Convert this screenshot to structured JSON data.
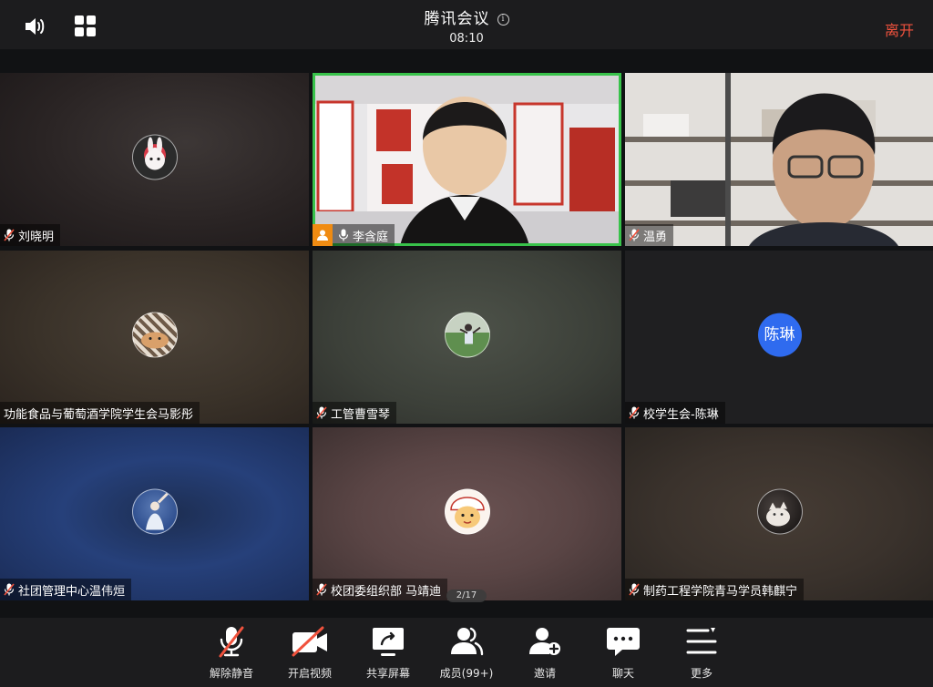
{
  "header": {
    "title": "腾讯会议",
    "time": "08:10",
    "leave_label": "离开"
  },
  "participants": [
    {
      "name": "刘晓明",
      "avatar_icon": "bunny-avatar-icon"
    },
    {
      "name": "李含庭",
      "speaking": true,
      "host": true
    },
    {
      "name": "温勇"
    },
    {
      "name": "功能食品与葡萄酒学院学生会马影彤",
      "avatar_icon": "dog-avatar-icon"
    },
    {
      "name": "工管曹雪琴",
      "avatar_icon": "photo-avatar-icon"
    },
    {
      "name": "校学生会-陈琳",
      "avatar_text": "陈琳"
    },
    {
      "name": "社团管理中心温伟烜",
      "avatar_icon": "photo-avatar-icon"
    },
    {
      "name": "校团委组织部 马靖迪",
      "avatar_icon": "cartoon-avatar-icon"
    },
    {
      "name": "制药工程学院青马学员韩麒宁",
      "avatar_icon": "cat-avatar-icon"
    }
  ],
  "pagination": "2/17",
  "toolbar": {
    "unmute": "解除静音",
    "start_video": "开启视频",
    "share_screen": "共享屏幕",
    "members": "成员(99+)",
    "invite": "邀请",
    "chat": "聊天",
    "more": "更多"
  },
  "colors": {
    "accent_red": "#f0523d",
    "speaking_green": "#38c24a",
    "host_orange": "#f08b12",
    "avatar_blue": "#2f6bef"
  }
}
